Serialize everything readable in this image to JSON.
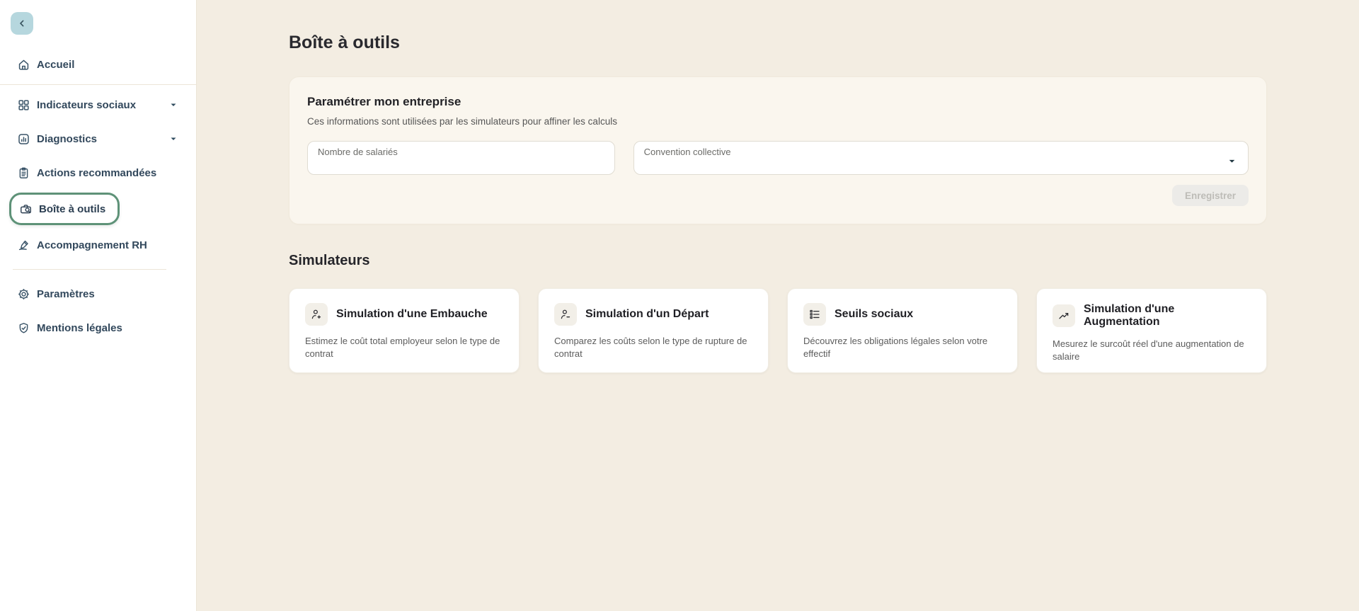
{
  "colors": {
    "page_background": "#f3ede2",
    "sidebar_background": "#ffffff",
    "accent_green": "#5e9278",
    "collapse_button_blue": "#b6d7de",
    "sidebar_text": "#32485c",
    "disabled_button_bg": "#ecebe8",
    "disabled_button_text": "#bdbcb7",
    "settings_card_bg": "#faf6ee"
  },
  "sidebar": {
    "collapse_icon": "chevron-left",
    "items": [
      {
        "label": "Accueil",
        "icon": "home-icon",
        "selected": false,
        "expandable": false
      },
      {
        "label": "Indicateurs sociaux",
        "icon": "grid-icon",
        "selected": false,
        "expandable": true
      },
      {
        "label": "Diagnostics",
        "icon": "bar-chart-icon",
        "selected": false,
        "expandable": true
      },
      {
        "label": "Actions recommandées",
        "icon": "clipboard-icon",
        "selected": false,
        "expandable": false
      },
      {
        "label": "Boîte à outils",
        "icon": "toolbox-search-icon",
        "selected": true,
        "expandable": false
      },
      {
        "label": "Accompagnement RH",
        "icon": "writing-hand-icon",
        "selected": false,
        "expandable": false
      },
      {
        "label": "Paramètres",
        "icon": "gear-icon",
        "selected": false,
        "expandable": false
      },
      {
        "label": "Mentions légales",
        "icon": "shield-check-icon",
        "selected": false,
        "expandable": false
      }
    ]
  },
  "main": {
    "page_title": "Boîte à outils",
    "settings_card": {
      "title": "Paramétrer mon entreprise",
      "subtitle": "Ces informations sont utilisées par les simulateurs pour affiner les calculs",
      "employee_field": {
        "label": "Nombre de salariés",
        "value": ""
      },
      "agreement_field": {
        "label": "Convention collective",
        "value": ""
      },
      "save_button_label": "Enregistrer",
      "save_button_state": "disabled"
    },
    "simulators": {
      "section_title": "Simulateurs",
      "cards": [
        {
          "title": "Simulation d'une Embauche",
          "description": "Estimez le coût total employeur selon le type de contrat",
          "icon": "user-plus-icon"
        },
        {
          "title": "Simulation d'un Départ",
          "description": "Comparez les coûts selon le type de rupture de contrat",
          "icon": "user-minus-icon"
        },
        {
          "title": "Seuils sociaux",
          "description": "Découvrez les obligations légales selon votre effectif",
          "icon": "checklist-icon"
        },
        {
          "title": "Simulation d'une Augmentation",
          "description": "Mesurez le surcoût réel d'une augmentation de salaire",
          "icon": "trending-up-icon"
        }
      ]
    }
  }
}
